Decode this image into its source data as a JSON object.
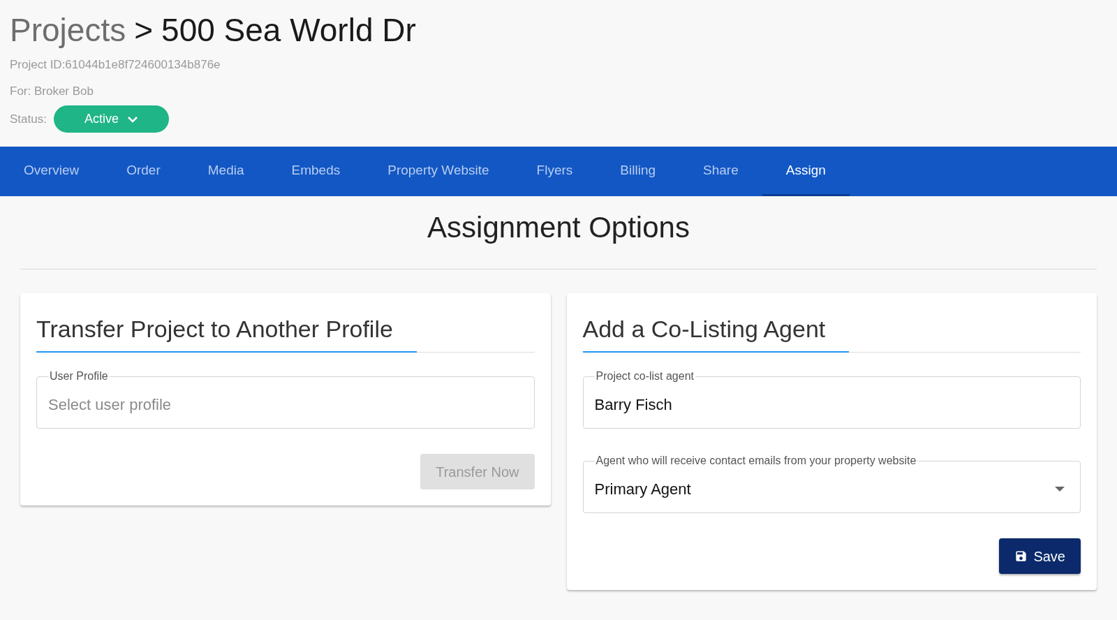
{
  "header": {
    "breadcrumb_parent": "Projects",
    "separator": ">",
    "title": "500 Sea World Dr",
    "project_id": "Project ID:61044b1e8f724600134b876e",
    "for": "For: Broker Bob",
    "status_label": "Status:",
    "status": "Active"
  },
  "tabs": [
    {
      "label": "Overview",
      "selected": false
    },
    {
      "label": "Order",
      "selected": false
    },
    {
      "label": "Media",
      "selected": false
    },
    {
      "label": "Embeds",
      "selected": false
    },
    {
      "label": "Property Website",
      "selected": false
    },
    {
      "label": "Flyers",
      "selected": false
    },
    {
      "label": "Billing",
      "selected": false
    },
    {
      "label": "Share",
      "selected": false
    },
    {
      "label": "Assign",
      "selected": true
    }
  ],
  "page_title": "Assignment Options",
  "cards": [
    {
      "title": "Transfer Project to Another Profile",
      "fields": [
        {
          "kind": "text",
          "label": "User Profile",
          "placeholder": "Select user profile"
        }
      ],
      "button": {
        "label": "Transfer Now",
        "disabled": true,
        "icon": false
      }
    },
    {
      "title": "Add a Co-Listing Agent",
      "fields": [
        {
          "kind": "text",
          "label": "Project co-list agent",
          "value": "Barry Fisch"
        },
        {
          "kind": "select",
          "label": "Agent who will receive contact emails from your property website",
          "value": "Primary Agent"
        }
      ],
      "button": {
        "label": "Save",
        "disabled": false,
        "icon": true
      }
    }
  ]
}
